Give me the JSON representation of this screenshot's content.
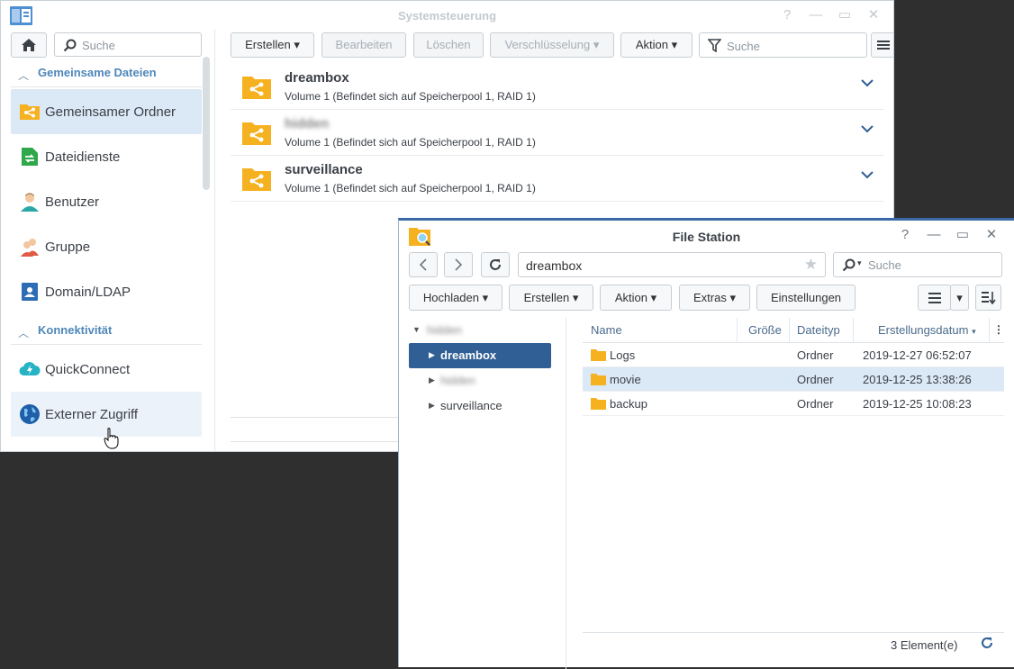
{
  "control_panel": {
    "title": "Systemsteuerung",
    "sidebar": {
      "search_placeholder": "Suche",
      "sections": [
        {
          "label": "Gemeinsame Dateien"
        },
        {
          "label": "Konnektivität"
        }
      ],
      "items": [
        {
          "label": "Gemeinsamer Ordner",
          "icon": "shared-folder-icon"
        },
        {
          "label": "Dateidienste",
          "icon": "file-services-icon"
        },
        {
          "label": "Benutzer",
          "icon": "user-icon"
        },
        {
          "label": "Gruppe",
          "icon": "group-icon"
        },
        {
          "label": "Domain/LDAP",
          "icon": "domain-ldap-icon"
        },
        {
          "label": "QuickConnect",
          "icon": "quickconnect-icon"
        },
        {
          "label": "Externer Zugriff",
          "icon": "globe-icon"
        }
      ]
    },
    "toolbar": {
      "create": "Erstellen",
      "edit": "Bearbeiten",
      "delete": "Löschen",
      "encryption": "Verschlüsselung",
      "action": "Aktion",
      "search_placeholder": "Suche"
    },
    "folders": [
      {
        "name": "dreambox",
        "location": "Volume 1 (Befindet sich auf Speicherpool 1, RAID 1)"
      },
      {
        "name": "hidden",
        "location": "Volume 1 (Befindet sich auf Speicherpool 1, RAID 1)"
      },
      {
        "name": "surveillance",
        "location": "Volume 1 (Befindet sich auf Speicherpool 1, RAID 1)"
      }
    ]
  },
  "file_station": {
    "title": "File Station",
    "path": "dreambox",
    "search_placeholder": "Suche",
    "toolbar": {
      "upload": "Hochladen",
      "create": "Erstellen",
      "action": "Aktion",
      "extras": "Extras",
      "settings": "Einstellungen"
    },
    "tree": {
      "root": "hidden",
      "items": [
        {
          "label": "dreambox"
        },
        {
          "label": "hidden"
        },
        {
          "label": "surveillance"
        }
      ]
    },
    "columns": {
      "name": "Name",
      "size": "Größe",
      "type": "Dateityp",
      "created": "Erstellungsdatum"
    },
    "files": [
      {
        "name": "Logs",
        "size": "",
        "type": "Ordner",
        "created": "2019-12-27 06:52:07"
      },
      {
        "name": "movie",
        "size": "",
        "type": "Ordner",
        "created": "2019-12-25 13:38:26"
      },
      {
        "name": "backup",
        "size": "",
        "type": "Ordner",
        "created": "2019-12-25 10:08:23"
      }
    ],
    "status": "3 Element(e)"
  },
  "colors": {
    "accent": "#2f5f94",
    "folder_yellow": "#f5b120",
    "selection": "#dbe8f6",
    "section_label": "#4e87b9"
  }
}
